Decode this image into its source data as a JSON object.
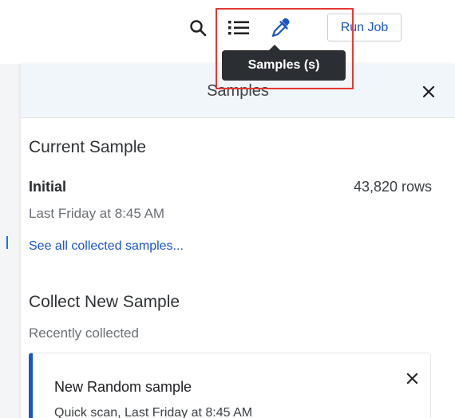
{
  "toolbar": {
    "icons": [
      "search-icon",
      "list-icon",
      "eyedropper-icon"
    ],
    "run_job_label": "Run Job",
    "accent_color": "#1a55c8"
  },
  "tooltip": {
    "text": "Samples (s)"
  },
  "panel": {
    "title": "Samples",
    "current_sample": {
      "heading": "Current Sample",
      "name": "Initial",
      "rows": "43,820 rows",
      "collected": "Last Friday at 8:45 AM",
      "see_all_link": "See all collected samples..."
    },
    "collect_new": {
      "heading": "Collect New Sample",
      "recent_label": "Recently collected",
      "cards": [
        {
          "title": "New Random sample",
          "description": "Quick scan, Last Friday at 8:45 AM"
        }
      ]
    }
  }
}
